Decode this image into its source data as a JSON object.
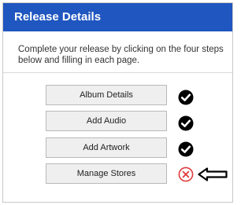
{
  "header": {
    "title": "Release Details",
    "background_color": "#1f56bf"
  },
  "intro": {
    "text": "Complete your release by clicking on the four steps below and filling in each page."
  },
  "steps": [
    {
      "label": "Album Details",
      "status": "complete",
      "status_icon": "check-circle-icon"
    },
    {
      "label": "Add Audio",
      "status": "complete",
      "status_icon": "check-circle-icon"
    },
    {
      "label": "Add Artwork",
      "status": "complete",
      "status_icon": "check-circle-icon"
    },
    {
      "label": "Manage Stores",
      "status": "incomplete",
      "status_icon": "x-circle-icon"
    }
  ],
  "colors": {
    "complete": "#000000",
    "incomplete": "#e03c3c"
  },
  "pointer_icon": "arrow-left-icon"
}
